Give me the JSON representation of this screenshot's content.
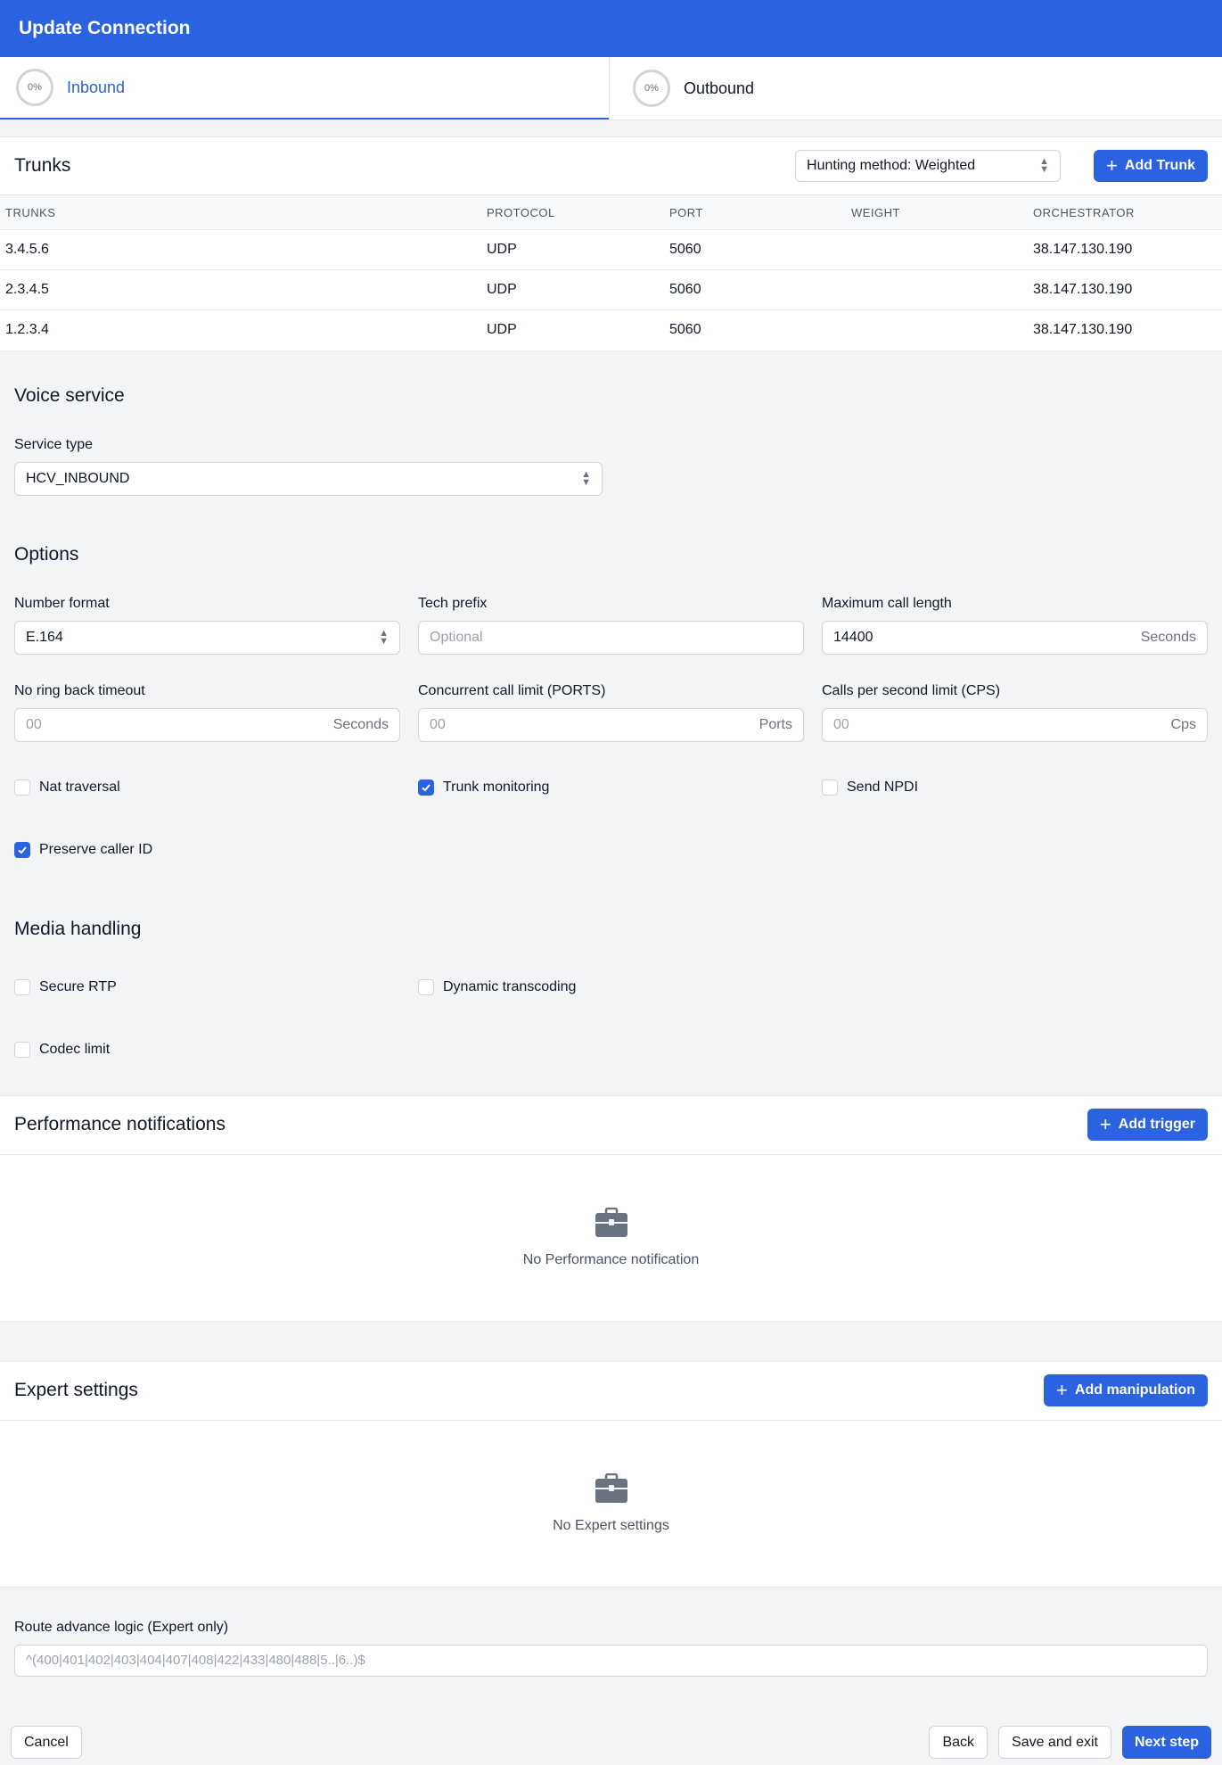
{
  "header": {
    "title": "Update Connection"
  },
  "tabs": [
    {
      "progress": "0%",
      "label": "Inbound"
    },
    {
      "progress": "0%",
      "label": "Outbound"
    }
  ],
  "trunks": {
    "title": "Trunks",
    "hunting_method": "Hunting method: Weighted",
    "add_label": "Add Trunk",
    "columns": [
      "TRUNKS",
      "PROTOCOL",
      "PORT",
      "WEIGHT",
      "ORCHESTRATOR"
    ],
    "rows": [
      [
        "3.4.5.6",
        "UDP",
        "5060",
        "",
        "38.147.130.190"
      ],
      [
        "2.3.4.5",
        "UDP",
        "5060",
        "",
        "38.147.130.190"
      ],
      [
        "1.2.3.4",
        "UDP",
        "5060",
        "",
        "38.147.130.190"
      ]
    ]
  },
  "voice": {
    "title": "Voice service",
    "service_type_label": "Service type",
    "service_type_value": "HCV_INBOUND"
  },
  "options": {
    "title": "Options",
    "number_format_label": "Number format",
    "number_format_value": "E.164",
    "tech_prefix_label": "Tech prefix",
    "tech_prefix_placeholder": "Optional",
    "max_call_label": "Maximum call length",
    "max_call_value": "14400",
    "max_call_suffix": "Seconds",
    "ring_back_label": "No ring back timeout",
    "ring_back_placeholder": "00",
    "ring_back_suffix": "Seconds",
    "concurrent_label": "Concurrent call limit (PORTS)",
    "concurrent_placeholder": "00",
    "concurrent_suffix": "Ports",
    "cps_label": "Calls per second limit (CPS)",
    "cps_placeholder": "00",
    "cps_suffix": "Cps",
    "nat_label": "Nat traversal",
    "nat_checked": false,
    "trunk_mon_label": "Trunk monitoring",
    "trunk_mon_checked": true,
    "npdi_label": "Send NPDI",
    "npdi_checked": false,
    "preserve_label": "Preserve caller ID",
    "preserve_checked": true
  },
  "media": {
    "title": "Media handling",
    "secure_rtp_label": "Secure RTP",
    "dynamic_label": "Dynamic transcoding",
    "codec_label": "Codec limit"
  },
  "perf": {
    "title": "Performance notifications",
    "add_label": "Add trigger",
    "empty_text": "No Performance notification",
    "empty_icon": "briefcase-icon"
  },
  "expert": {
    "title": "Expert settings",
    "add_label": "Add manipulation",
    "empty_text": "No Expert settings",
    "empty_icon": "briefcase-icon"
  },
  "route": {
    "label": "Route advance logic (Expert only)",
    "placeholder": "^(400|401|402|403|404|407|408|422|433|480|488|5..|6..)$"
  },
  "footer": {
    "cancel_label": "Cancel",
    "back_label": "Back",
    "save_exit_label": "Save and exit",
    "next_label": "Next step"
  },
  "colors": {
    "accent": "#2b62e0",
    "background": "#f3f4f6"
  }
}
